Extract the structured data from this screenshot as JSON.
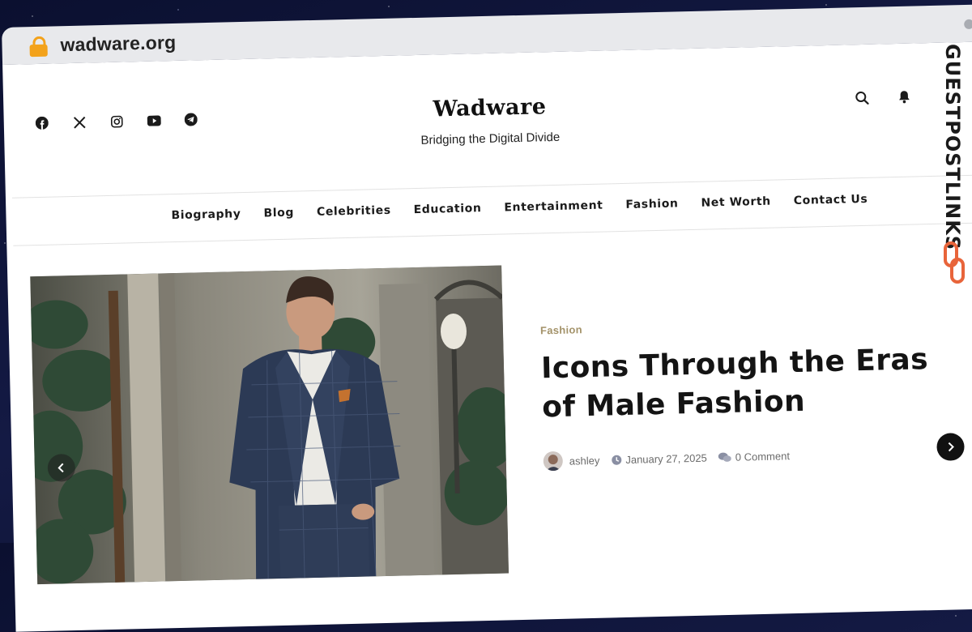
{
  "browser": {
    "url": "wadware.org",
    "lock_icon": "lock-icon",
    "accent": "#f3a21b"
  },
  "header": {
    "social_icons": [
      "facebook-icon",
      "x-icon",
      "instagram-icon",
      "youtube-icon",
      "telegram-icon"
    ],
    "site_title": "Wadware",
    "tagline": "Bridging the Digital Divide",
    "actions": [
      "search-icon",
      "bell-icon"
    ]
  },
  "nav": {
    "items": [
      "Biography",
      "Blog",
      "Celebrities",
      "Education",
      "Entertainment",
      "Fashion",
      "Net Worth",
      "Contact Us"
    ]
  },
  "featured": {
    "category": "Fashion",
    "title": "Icons Through the Eras of Male Fashion",
    "author": "ashley",
    "date": "January 27, 2025",
    "comments": "0 Comment",
    "category_color": "#a4936a"
  },
  "watermark": {
    "text": "GUESTPOSTLINKS",
    "logo_color": "#e8643a"
  }
}
